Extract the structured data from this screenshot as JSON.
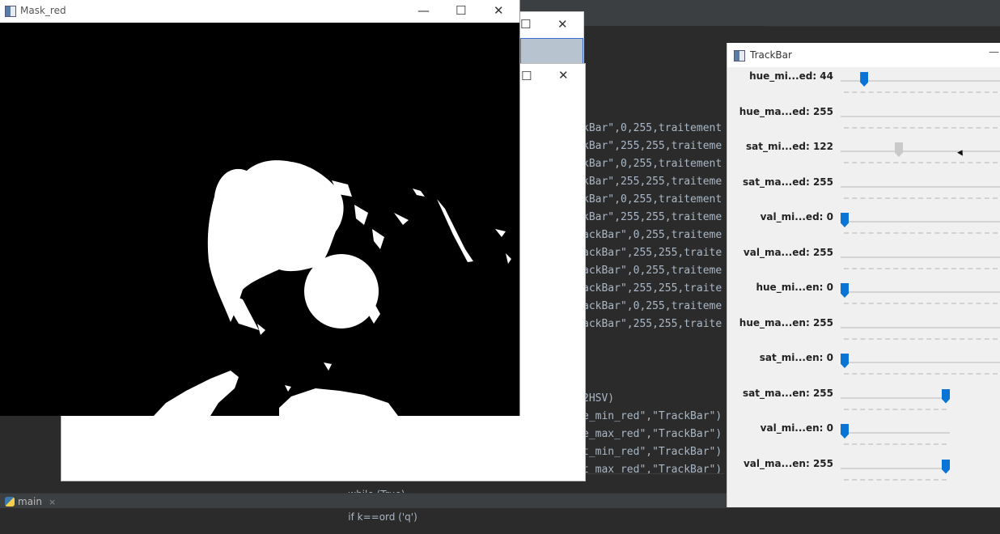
{
  "mask_window": {
    "title": "Mask_red",
    "minimize_glyph": "—",
    "maximize_glyph": "☐",
    "close_glyph": "✕"
  },
  "back_window": {
    "close_glyph": "✕",
    "maximize_glyph": "☐"
  },
  "white_window": {
    "close_glyph": "✕",
    "maximize_glyph": "☐"
  },
  "trackbar_window": {
    "title": "TrackBar",
    "minimize_glyph": "—",
    "sliders": [
      {
        "label": "hue_mi...ed: 44",
        "value": 44,
        "max": 255
      },
      {
        "label": "hue_ma...ed: 255",
        "value": 255,
        "max": 255
      },
      {
        "label": "sat_mi...ed: 122",
        "value": 122,
        "max": 255
      },
      {
        "label": "sat_ma...ed: 255",
        "value": 255,
        "max": 255
      },
      {
        "label": "val_mi...ed: 0",
        "value": 0,
        "max": 255
      },
      {
        "label": "val_ma...ed: 255",
        "value": 255,
        "max": 255
      },
      {
        "label": "hue_mi...en: 0",
        "value": 0,
        "max": 255
      },
      {
        "label": "hue_ma...en: 255",
        "value": 255,
        "max": 255
      },
      {
        "label": "sat_mi...en: 0",
        "value": 0,
        "max": 255
      },
      {
        "label": "sat_ma...en: 255",
        "value": 255,
        "max": 255
      },
      {
        "label": "val_mi...en: 0",
        "value": 0,
        "max": 255
      },
      {
        "label": "val_ma...en: 255",
        "value": 255,
        "max": 255
      }
    ]
  },
  "code_lines": [
    "kBar\",0,255,traitement",
    "kBar\",255,255,traiteme",
    "kBar\",0,255,traitement",
    "kBar\",255,255,traiteme",
    "kBar\",0,255,traitement",
    "kBar\",255,255,traiteme",
    "ackBar\",0,255,traiteme",
    "ackBar\",255,255,traite",
    "ackBar\",0,255,traiteme",
    "ackBar\",255,255,traite",
    "ackBar\",0,255,traiteme",
    "ackBar\",255,255,traite",
    "2HSV)",
    "e_min_red\",\"TrackBar\")",
    "e_max_red\",\"TrackBar\")",
    "t_min_red\",\"TrackBar\")",
    "t_max_red\",\"TrackBar\")"
  ],
  "breadcrumb": {
    "part1": "while (True)",
    "separator": "›",
    "part2": "if k==ord ('q')"
  },
  "run_tab": {
    "label": "main",
    "close_glyph": "×"
  }
}
